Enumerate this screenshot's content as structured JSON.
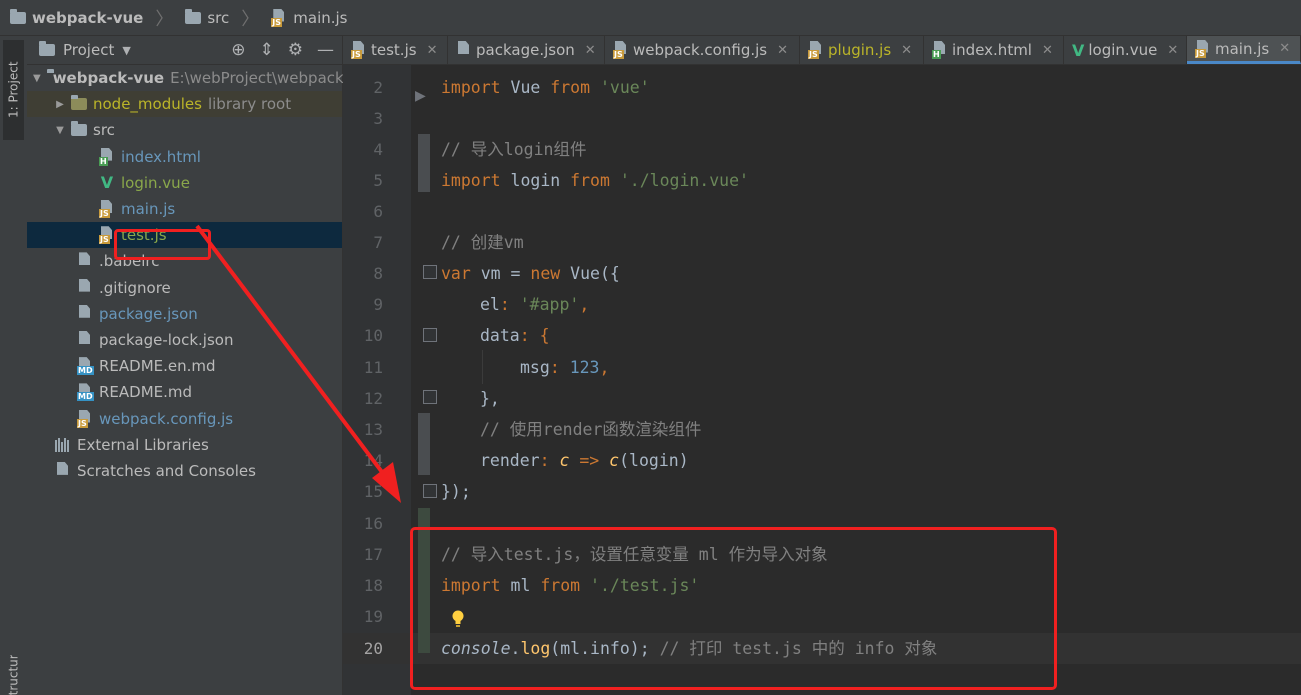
{
  "breadcrumb": {
    "project": "webpack-vue",
    "folder": "src",
    "file": "main.js"
  },
  "left_strip": {
    "project_tab": "1: Project",
    "structure_tab": "Structure"
  },
  "project_panel": {
    "title": "Project"
  },
  "tree": {
    "root": {
      "label": "webpack-vue",
      "path": "E:\\webProject\\webpack-vue"
    },
    "node_modules": {
      "label": "node_modules",
      "hint": "library root"
    },
    "src": "src",
    "index_html": "index.html",
    "login_vue": "login.vue",
    "main_js": "main.js",
    "test_js": "test.js",
    "babelrc": ".babelrc",
    "gitignore": ".gitignore",
    "package_json": "package.json",
    "package_lock": "package-lock.json",
    "readme_en": "README.en.md",
    "readme": "README.md",
    "webpack_config": "webpack.config.js",
    "external_libraries": "External Libraries",
    "scratches": "Scratches and Consoles"
  },
  "tabs": [
    {
      "label": "test.js"
    },
    {
      "label": "package.json"
    },
    {
      "label": "webpack.config.js"
    },
    {
      "label": "plugin.js"
    },
    {
      "label": "index.html"
    },
    {
      "label": "login.vue"
    },
    {
      "label": "main.js"
    }
  ],
  "code": {
    "l2": {
      "n": "2",
      "a": "import",
      "b": " Vue ",
      "c": "from",
      "d": " 'vue'"
    },
    "l3": {
      "n": "3"
    },
    "l4": {
      "n": "4",
      "cm": "// 导入login组件"
    },
    "l5": {
      "n": "5",
      "a": "import",
      "b": " login ",
      "c": "from",
      "d": " './login.vue'"
    },
    "l6": {
      "n": "6"
    },
    "l7": {
      "n": "7",
      "cm": "// 创建vm"
    },
    "l8": {
      "n": "8",
      "a": "var",
      "b": " vm = ",
      "c": "new",
      "d": " Vue({"
    },
    "l9": {
      "n": "9",
      "a": "el",
      "b": ": ",
      "c": "'#app'",
      "d": ","
    },
    "l10": {
      "n": "10",
      "a": "data",
      "b": ": {"
    },
    "l11": {
      "n": "11",
      "a": "msg",
      "b": ": ",
      "c": "123",
      "d": ","
    },
    "l12": {
      "n": "12",
      "a": "},"
    },
    "l13": {
      "n": "13",
      "cm": "// 使用render函数渲染组件"
    },
    "l14": {
      "n": "14",
      "a": "render",
      "b": ": ",
      "c": "c",
      "d": " => ",
      "e": "c",
      "f": "(login)"
    },
    "l15": {
      "n": "15",
      "a": "});"
    },
    "l16": {
      "n": "16"
    },
    "l17": {
      "n": "17",
      "cm": "// 导入test.js，设置任意变量 ml 作为导入对象"
    },
    "l18": {
      "n": "18",
      "a": "import",
      "b": " ml ",
      "c": "from",
      "d": " './test.js'"
    },
    "l19": {
      "n": "19"
    },
    "l20": {
      "n": "20",
      "a": "console",
      "b": ".",
      "c": "log",
      "d": "(ml.info); ",
      "cm": "// 打印 test.js 中的 info 对象"
    }
  }
}
